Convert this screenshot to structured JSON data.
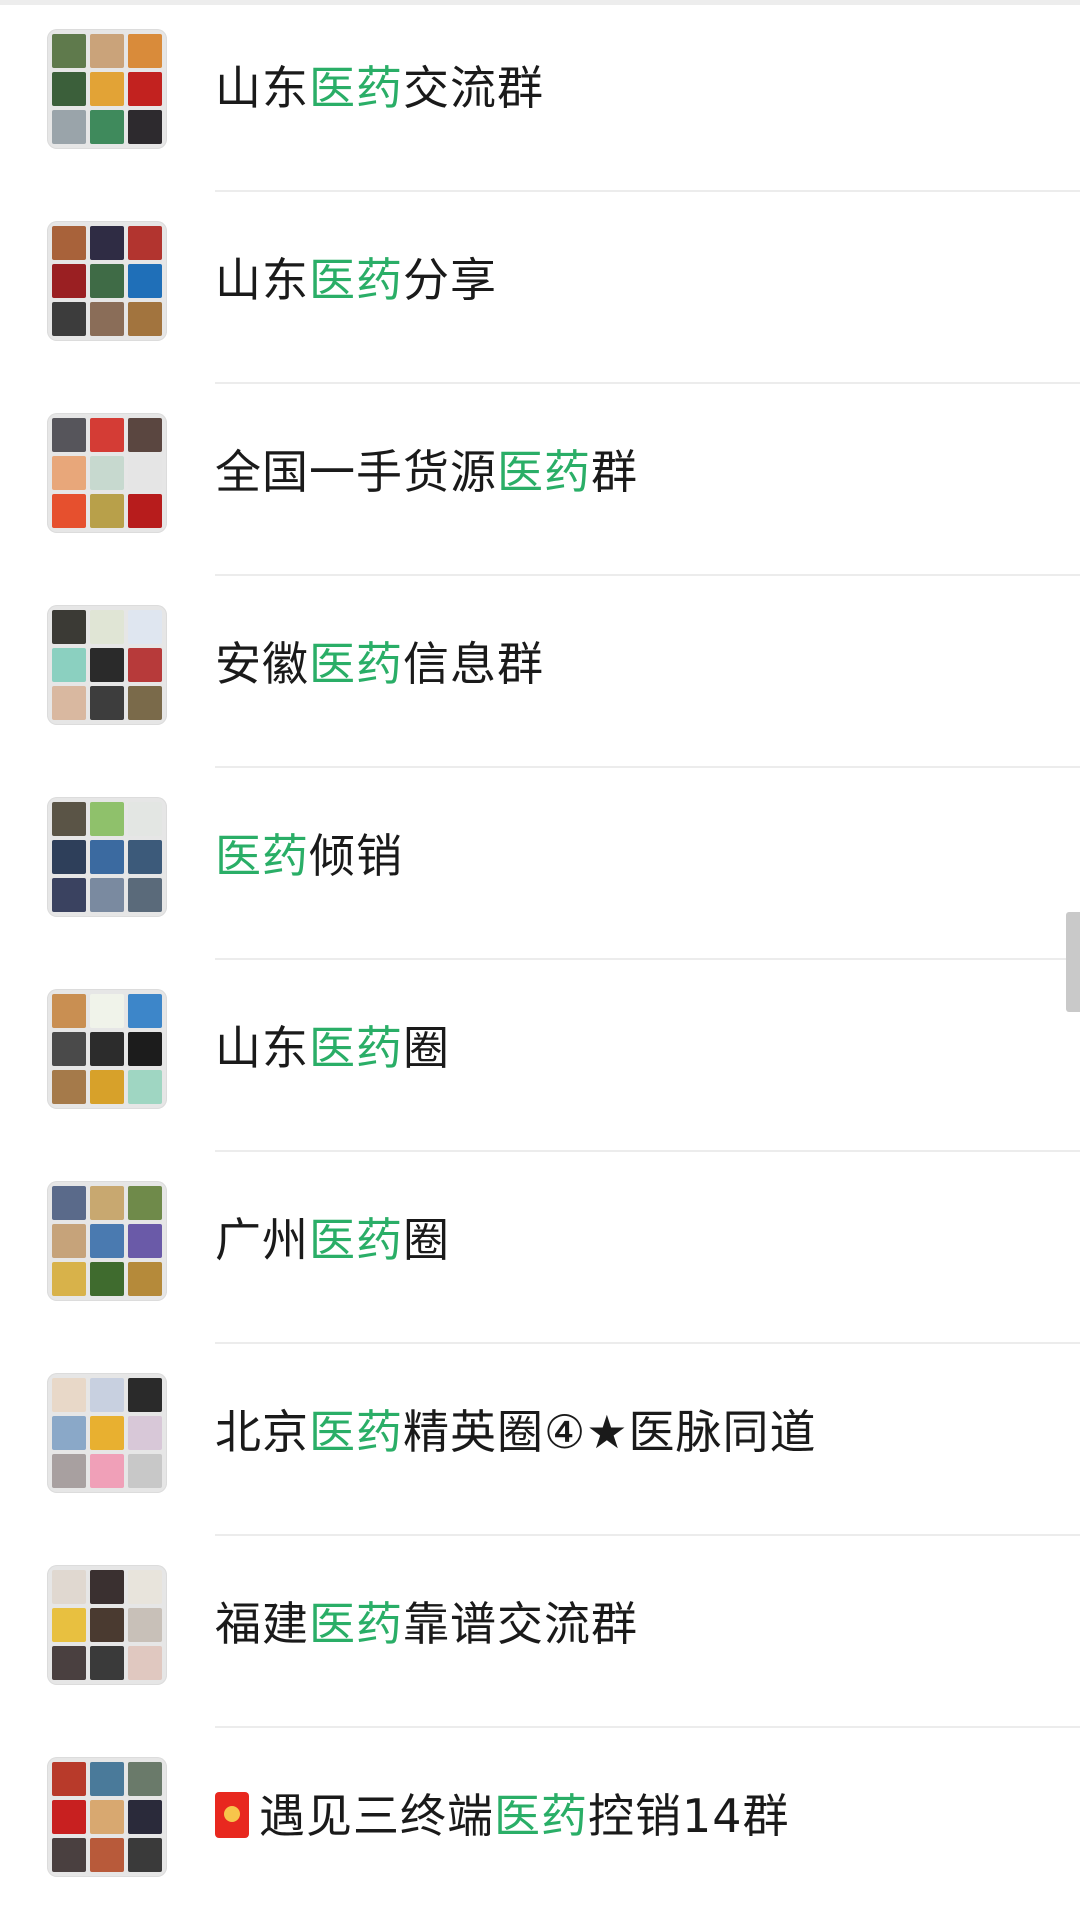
{
  "groups": [
    {
      "pre": "山东",
      "kw": "医药",
      "post": "交流群",
      "icon": "",
      "tiles": [
        "#5f7a4c",
        "#caa37a",
        "#d98b3a",
        "#3b5f3a",
        "#e2a336",
        "#c2221f",
        "#9aa4aa",
        "#3f8a5c",
        "#2d2a2e"
      ]
    },
    {
      "pre": "山东",
      "kw": "医药",
      "post": "分享",
      "icon": "",
      "tiles": [
        "#a8623a",
        "#2f2c44",
        "#b2342f",
        "#9a1f22",
        "#3f6b46",
        "#1f6fb8",
        "#3c3c3c",
        "#8a6d58",
        "#a2743e"
      ]
    },
    {
      "pre": "全国一手货源",
      "kw": "医药",
      "post": "群",
      "icon": "",
      "tiles": [
        "#56555b",
        "#d43c35",
        "#5a4640",
        "#e8a77a",
        "#c7d9cf",
        "#e5e5e5",
        "#e6502e",
        "#b8a04a",
        "#b71c1c"
      ]
    },
    {
      "pre": "安徽",
      "kw": "医药",
      "post": "信息群",
      "icon": "",
      "tiles": [
        "#3b3a35",
        "#e0e5d5",
        "#dfe6f0",
        "#8bd0c0",
        "#2a2a2a",
        "#b73a3a",
        "#d9b8a0",
        "#3d3d3d",
        "#7a6a4a"
      ]
    },
    {
      "pre": "",
      "kw": "医药",
      "post": "倾销",
      "icon": "",
      "tiles": [
        "#5a5446",
        "#8fc16b",
        "#e3e6e3",
        "#2e3f5a",
        "#3b6aa0",
        "#3c5a7a",
        "#3a4260",
        "#7a8aa0",
        "#5a6a7a"
      ]
    },
    {
      "pre": "山东",
      "kw": "医药",
      "post": "圈",
      "icon": "",
      "tiles": [
        "#c98f52",
        "#f0f3ea",
        "#3d86c9",
        "#4a4a4a",
        "#2c2c2c",
        "#1c1c1c",
        "#a57a4a",
        "#d7a12a",
        "#9fd6c2"
      ]
    },
    {
      "pre": "广州",
      "kw": "医药",
      "post": "圈",
      "icon": "",
      "tiles": [
        "#5a6a8a",
        "#c8a870",
        "#6f8a4a",
        "#c6a37a",
        "#4a7ab0",
        "#6a5aa8",
        "#d8b24a",
        "#3f6b2e",
        "#b58a3a"
      ]
    },
    {
      "pre": "北京",
      "kw": "医药",
      "post": "精英圈④★医脉同道",
      "icon": "",
      "tiles": [
        "#e8d8c8",
        "#c8d0e0",
        "#2a2a2a",
        "#8aa8c8",
        "#e8b030",
        "#d8c8d8",
        "#a8a0a0",
        "#f0a0b8",
        "#c8c8c8"
      ]
    },
    {
      "pre": "福建",
      "kw": "医药",
      "post": "靠谱交流群",
      "icon": "",
      "tiles": [
        "#e0d8d0",
        "#3a3030",
        "#e8e4dc",
        "#e8c040",
        "#4a3a30",
        "#c8c0b8",
        "#4a4040",
        "#3a3a3a",
        "#e0c8c0"
      ]
    },
    {
      "pre": "遇见三终端",
      "kw": "医药",
      "post": "控销14群",
      "icon": "red-envelope",
      "tiles": [
        "#b83a2a",
        "#4a7a9a",
        "#6a7a6a",
        "#c82020",
        "#d8a870",
        "#2a2a3a",
        "#4a4040",
        "#b85a3a",
        "#3a3a3a"
      ]
    }
  ]
}
